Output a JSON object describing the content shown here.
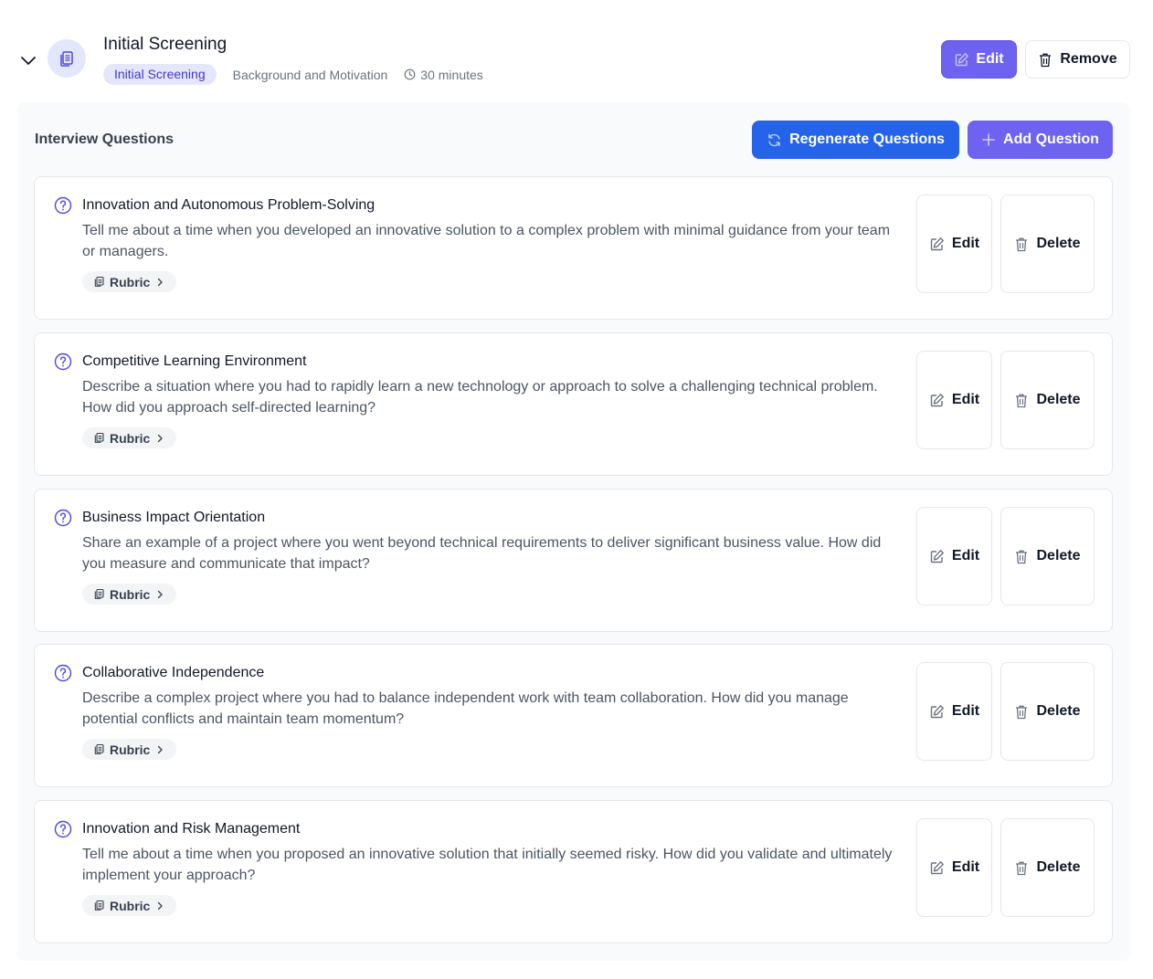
{
  "stage": {
    "title": "Initial Screening",
    "badge": "Initial Screening",
    "category": "Background and Motivation",
    "duration": "30 minutes",
    "edit_label": "Edit",
    "remove_label": "Remove"
  },
  "panel": {
    "title": "Interview Questions",
    "regenerate_label": "Regenerate Questions",
    "add_label": "Add Question"
  },
  "questions": [
    {
      "title": "Innovation and Autonomous Problem-Solving",
      "text": "Tell me about a time when you developed an innovative solution to a complex problem with minimal guidance from your team or managers.",
      "rubric": "Rubric",
      "edit": "Edit",
      "delete": "Delete"
    },
    {
      "title": "Competitive Learning Environment",
      "text": "Describe a situation where you had to rapidly learn a new technology or approach to solve a challenging technical problem. How did you approach self-directed learning?",
      "rubric": "Rubric",
      "edit": "Edit",
      "delete": "Delete"
    },
    {
      "title": "Business Impact Orientation",
      "text": "Share an example of a project where you went beyond technical requirements to deliver significant business value. How did you measure and communicate that impact?",
      "rubric": "Rubric",
      "edit": "Edit",
      "delete": "Delete"
    },
    {
      "title": "Collaborative Independence",
      "text": "Describe a complex project where you had to balance independent work with team collaboration. How did you manage potential conflicts and maintain team momentum?",
      "rubric": "Rubric",
      "edit": "Edit",
      "delete": "Delete"
    },
    {
      "title": "Innovation and Risk Management",
      "text": "Tell me about a time when you proposed an innovative solution that initially seemed risky. How did you validate and ultimately implement your approach?",
      "rubric": "Rubric",
      "edit": "Edit",
      "delete": "Delete"
    }
  ],
  "icons": {
    "chevron": "chevron-down-icon",
    "stage": "clipboard-icon",
    "clock": "clock-icon",
    "edit": "pencil-square-icon",
    "remove": "trash-icon",
    "regenerate": "refresh-icon",
    "add": "plus-icon",
    "question": "question-circle-icon",
    "rubric": "clipboard-icon",
    "rubric_chevron": "chevron-right-icon"
  },
  "colors": {
    "primary": "#6d63f0",
    "blue": "#2563eb",
    "badge_bg": "#e4e7fc",
    "badge_text": "#4338ca",
    "question_icon": "#4f46e5"
  }
}
